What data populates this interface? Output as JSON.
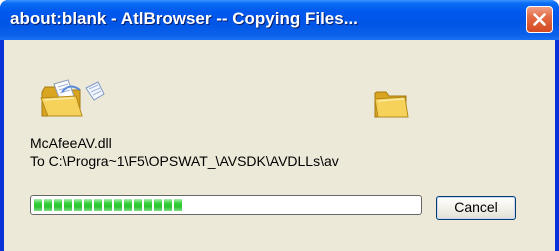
{
  "window": {
    "title": "about:blank - AtlBrowser -- Copying Files...",
    "title_bar_color": "#0058ee",
    "close_button_color": "#d44a20"
  },
  "animation": {
    "source_icon": "folder-with-flying-paper-icon",
    "target_icon": "folder-open-icon"
  },
  "copy": {
    "file_name": "McAfeeAV.dll",
    "destination": "To C:\\Progra~1\\F5\\OPSWAT_\\AVSDK\\AVDLLs\\av",
    "progress_fraction": 0.4,
    "progress_color": "#2bc230"
  },
  "buttons": {
    "cancel_label": "Cancel"
  }
}
